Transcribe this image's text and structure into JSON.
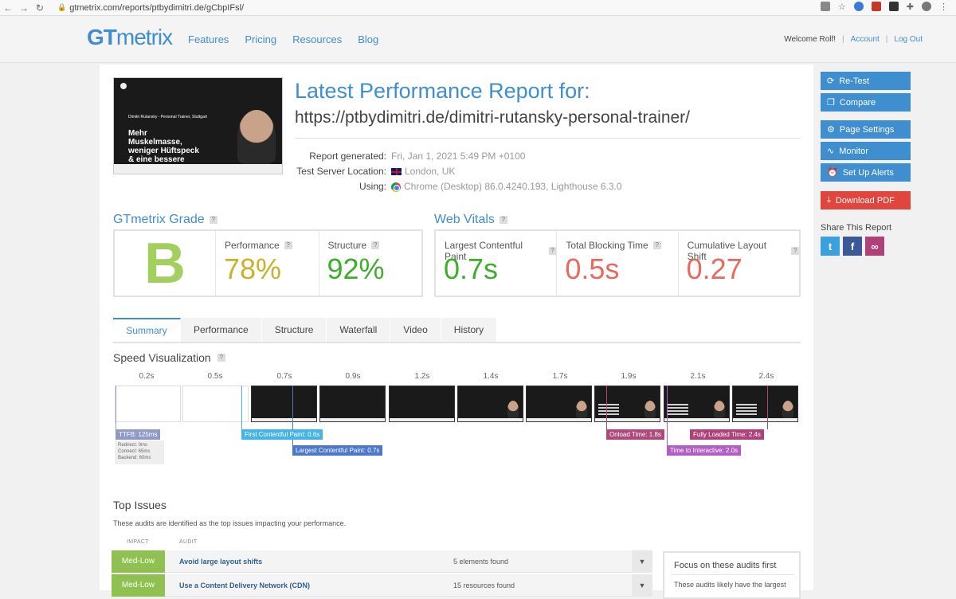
{
  "browser": {
    "url": "gtmetrix.com/reports/ptbydimitri.de/gCbpIFsl/"
  },
  "header": {
    "logo_gt": "GT",
    "logo_metrix": "metrix",
    "nav": [
      "Features",
      "Pricing",
      "Resources",
      "Blog"
    ],
    "welcome": "Welcome Rolf!",
    "account": "Account",
    "logout": "Log Out"
  },
  "report": {
    "title": "Latest Performance Report for:",
    "url": "https://ptbydimitri.de/dimitri-rutansky-personal-trainer/",
    "thumb_subline": "Dimitri Rutansky - Personal Trainer, Stuttgart",
    "thumb_headline": "Mehr Muskelmasse, weniger Hüftspeck & eine bessere Ausstrahlung",
    "meta": [
      {
        "label": "Report generated:",
        "value": "Fri, Jan 1, 2021 5:49 PM +0100"
      },
      {
        "label": "Test Server Location:",
        "value": "London, UK"
      },
      {
        "label": "Using:",
        "value": "Chrome (Desktop) 86.0.4240.193, Lighthouse 6.3.0"
      }
    ]
  },
  "grade": {
    "heading": "GTmetrix Grade",
    "letter": "B",
    "performance_label": "Performance",
    "performance_value": "78%",
    "structure_label": "Structure",
    "structure_value": "92%"
  },
  "vitals": {
    "heading": "Web Vitals",
    "items": [
      {
        "label": "Largest Contentful Paint",
        "value": "0.7s"
      },
      {
        "label": "Total Blocking Time",
        "value": "0.5s"
      },
      {
        "label": "Cumulative Layout Shift",
        "value": "0.27"
      }
    ]
  },
  "colors": {
    "accent": "#3e8ed0",
    "grade_green": "#a3cf5f",
    "performance_yellow": "#c9b22a",
    "good_green": "#3dae2b",
    "bad_red": "#e86a5e",
    "ttfb": "#8f9ac7",
    "fcp": "#43b4e8",
    "lcp": "#4a78cc",
    "onload": "#b0487a",
    "tti": "#b15fc4",
    "fully_loaded": "#b0407a"
  },
  "tabs": [
    "Summary",
    "Performance",
    "Structure",
    "Waterfall",
    "Video",
    "History"
  ],
  "speed": {
    "heading": "Speed Visualization",
    "ticks": [
      "0.2s",
      "0.5s",
      "0.7s",
      "0.9s",
      "1.2s",
      "1.4s",
      "1.7s",
      "1.9s",
      "2.1s",
      "2.4s"
    ],
    "ttfb": "TTFB: 125ms",
    "ttfb_redirect": "Redirect: 0ms",
    "ttfb_connect": "Connect: 65ms",
    "ttfb_backend": "Backend: 60ms",
    "fcp": "First Contentful Paint: 0.6s",
    "lcp": "Largest Contentful Paint: 0.7s",
    "onload": "Onload Time: 1.8s",
    "tti": "Time to Interactive: 2.0s",
    "fully_loaded": "Fully Loaded Time: 2.4s"
  },
  "issues": {
    "heading": "Top Issues",
    "subtitle": "These audits are identified as the top issues impacting your performance.",
    "col_impact": "IMPACT",
    "col_audit": "AUDIT",
    "rows": [
      {
        "impact": "Med-Low",
        "audit": "Avoid large layout shifts",
        "found": "5 elements found"
      },
      {
        "impact": "Med-Low",
        "audit": "Use a Content Delivery Network (CDN)",
        "found": "15 resources found"
      }
    ],
    "focus_title": "Focus on these audits first",
    "focus_text": "These audits likely have the largest"
  },
  "sidebar": {
    "retest": "Re-Test",
    "compare": "Compare",
    "page_settings": "Page Settings",
    "monitor": "Monitor",
    "alerts": "Set Up Alerts",
    "download": "Download PDF",
    "share_heading": "Share This Report"
  }
}
